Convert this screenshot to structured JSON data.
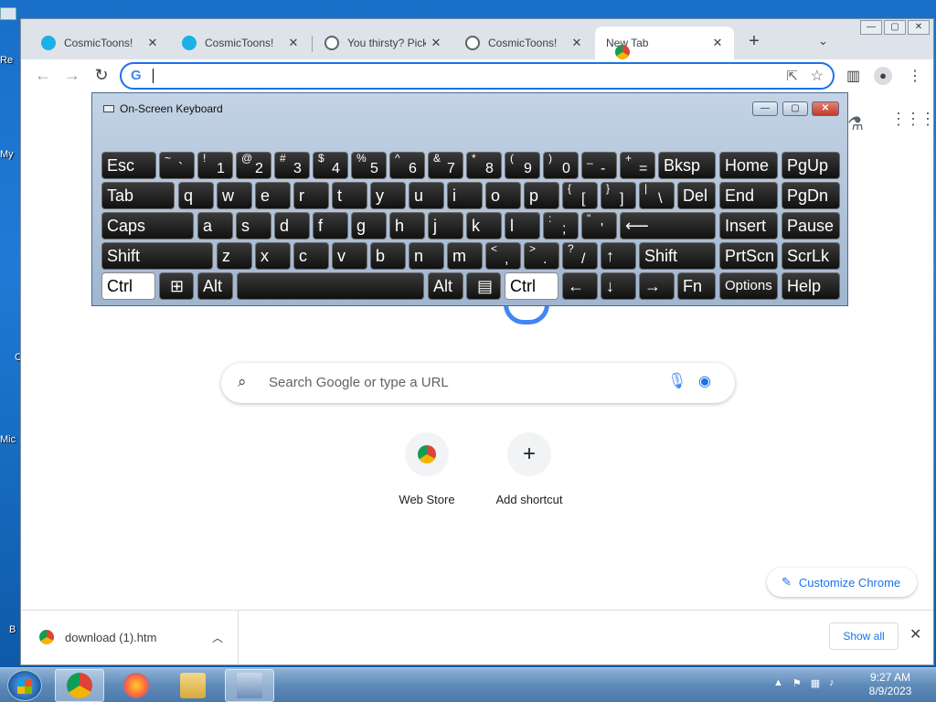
{
  "desktop": {
    "icons": [
      {
        "label": "Re"
      },
      {
        "label": "My"
      },
      {
        "label": "C"
      },
      {
        "label": "Mic"
      },
      {
        "label": "B"
      }
    ]
  },
  "browser": {
    "tabs": [
      {
        "title": "CosmicToons!",
        "favicon": "cosmic-icon",
        "active": false
      },
      {
        "title": "CosmicToons!",
        "favicon": "cosmic-icon",
        "active": false
      },
      {
        "title": "You thirsty? Pick",
        "favicon": "globe-icon",
        "active": false
      },
      {
        "title": "CosmicToons!",
        "favicon": "globe-icon",
        "active": false
      },
      {
        "title": "New Tab",
        "favicon": "chrome-icon",
        "active": true
      }
    ],
    "new_tab_symbol": "+",
    "omnibox": {
      "value": "",
      "placeholder": ""
    },
    "window_controls": {
      "minimize": "—",
      "maximize": "▢",
      "close": "✕"
    }
  },
  "newtab": {
    "search_placeholder": "Search Google or type a URL",
    "shortcuts": [
      {
        "label": "Web Store",
        "icon": "web-store-icon"
      },
      {
        "label": "Add shortcut",
        "icon": "plus-icon"
      }
    ],
    "add_symbol": "+",
    "customize_label": "Customize Chrome"
  },
  "downloads": {
    "items": [
      {
        "filename": "download (1).htm"
      }
    ],
    "show_all_label": "Show all"
  },
  "osk": {
    "title": "On-Screen Keyboard",
    "keys": {
      "esc": "Esc",
      "bksp": "Bksp",
      "home": "Home",
      "pgup": "PgUp",
      "tab": "Tab",
      "del": "Del",
      "end": "End",
      "pgdn": "PgDn",
      "caps": "Caps",
      "insert": "Insert",
      "pause": "Pause",
      "shift": "Shift",
      "prtscn": "PrtScn",
      "scrlk": "ScrLk",
      "ctrl": "Ctrl",
      "alt": "Alt",
      "fn": "Fn",
      "options": "Options",
      "help": "Help",
      "row1": [
        {
          "shift": "~",
          "main": "`"
        },
        {
          "shift": "!",
          "main": "1"
        },
        {
          "shift": "@",
          "main": "2"
        },
        {
          "shift": "#",
          "main": "3"
        },
        {
          "shift": "$",
          "main": "4"
        },
        {
          "shift": "%",
          "main": "5"
        },
        {
          "shift": "^",
          "main": "6"
        },
        {
          "shift": "&",
          "main": "7"
        },
        {
          "shift": "*",
          "main": "8"
        },
        {
          "shift": "(",
          "main": "9"
        },
        {
          "shift": ")",
          "main": "0"
        },
        {
          "shift": "_",
          "main": "-"
        },
        {
          "shift": "+",
          "main": "="
        }
      ],
      "row2": [
        "q",
        "w",
        "e",
        "r",
        "t",
        "y",
        "u",
        "i",
        "o",
        "p"
      ],
      "row2_sym": [
        {
          "shift": "{",
          "main": "["
        },
        {
          "shift": "}",
          "main": "]"
        },
        {
          "shift": "|",
          "main": "\\"
        }
      ],
      "row3": [
        "a",
        "s",
        "d",
        "f",
        "g",
        "h",
        "j",
        "k",
        "l"
      ],
      "row3_sym": [
        {
          "shift": ":",
          "main": ";"
        },
        {
          "shift": "\"",
          "main": "'"
        }
      ],
      "row4": [
        "z",
        "x",
        "c",
        "v",
        "b",
        "n",
        "m"
      ],
      "row4_sym": [
        {
          "shift": "<",
          "main": ","
        },
        {
          "shift": ">",
          "main": "."
        },
        {
          "shift": "?",
          "main": "/"
        }
      ],
      "arrows": {
        "up": "↑",
        "left": "←",
        "down": "↓",
        "right": "→"
      },
      "enter_symbol": "⟵"
    }
  },
  "taskbar": {
    "time": "9:27 AM",
    "date": "8/9/2023"
  }
}
